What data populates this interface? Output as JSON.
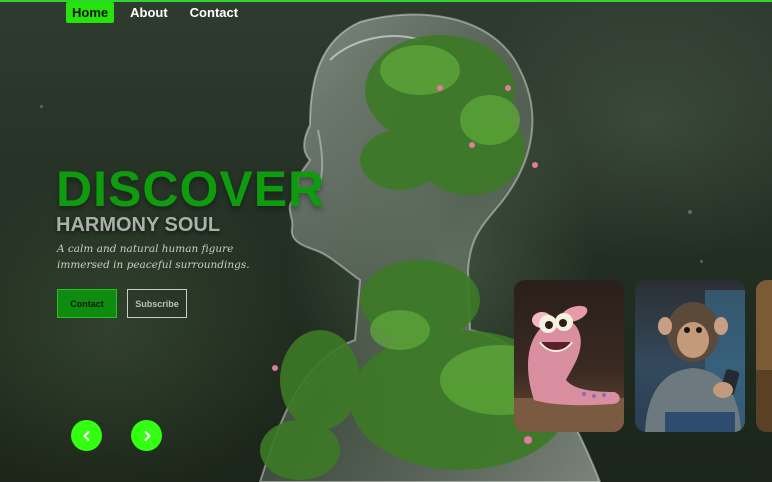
{
  "nav": {
    "items": [
      {
        "label": "Home",
        "active": true
      },
      {
        "label": "About",
        "active": false
      },
      {
        "label": "Contact",
        "active": false
      }
    ]
  },
  "hero": {
    "title": "DISCOVER",
    "subtitle": "HARMONY SOUL",
    "description": "A calm and natural human figure immersed in peaceful surroundings.",
    "contact_button": "Contact",
    "subscribe_button": "Subscribe"
  },
  "carousel": {
    "cards": [
      {
        "icon": "pink-worm-creature-image"
      },
      {
        "icon": "chimpanzee-with-phone-image"
      },
      {
        "icon": "partial-card-image"
      }
    ],
    "prev_icon": "chevron-left-icon",
    "next_icon": "chevron-right-icon"
  },
  "colors": {
    "accent": "#25e40c",
    "title_green": "#0e9b0e",
    "button_green": "#0f8c0f",
    "arrow_green": "#33ff12"
  }
}
